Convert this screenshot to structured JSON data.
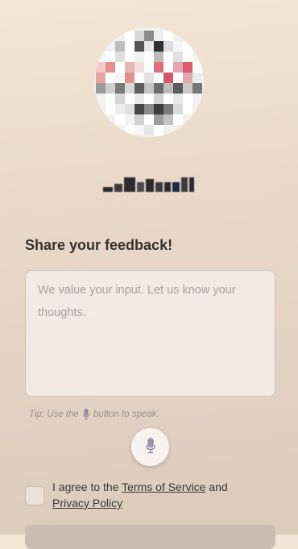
{
  "logo": {
    "name": "pixelated-logo",
    "rows": [
      [
        "",
        "",
        "",
        "#ffffff",
        "#d8d8d8",
        "#8a8a8a",
        "#f0f0f0",
        "#ffffff",
        "",
        "",
        ""
      ],
      [
        "",
        "#f2f2f2",
        "#bdbdbd",
        "#ffffff",
        "#555555",
        "#e8e8e8",
        "#2f2f2f",
        "#dcdcdc",
        "#f5f5f5",
        "#ffffff",
        ""
      ],
      [
        "#f4f4f4",
        "#ffffff",
        "#dedede",
        "#ffffff",
        "#f0f0f0",
        "#ffffff",
        "#bbbbbb",
        "#ffffff",
        "#e0e0e0",
        "#ffffff",
        "#f2f2f2"
      ],
      [
        "#f3c9c9",
        "#e88d8d",
        "#ffffff",
        "#e4b6b6",
        "#f6dede",
        "#ffffff",
        "#e06d7a",
        "#ffffff",
        "#e6a5b0",
        "#d8606e",
        "#ffffff"
      ],
      [
        "#e7a3a3",
        "#ffffff",
        "#f6f6f6",
        "#e08f8f",
        "#ffffff",
        "#e2e2e2",
        "#ffffff",
        "#d85565",
        "#ffffff",
        "#e3a7ae",
        "#ececec"
      ],
      [
        "#9b9b9b",
        "#cfcfcf",
        "#7a7a7a",
        "#d8d8d8",
        "#5e5e5e",
        "#c4c4c4",
        "#6c6c6c",
        "#bebebe",
        "#5c5c5c",
        "#c9c9c9",
        "#777777"
      ],
      [
        "#f3f3f3",
        "#ffffff",
        "#d6d6d6",
        "#ffffff",
        "#eaeaea",
        "#ffffff",
        "#d2d2d2",
        "#ffffff",
        "#e8e8e8",
        "#ffffff",
        "#f1f1f1"
      ],
      [
        "",
        "#ffffff",
        "#ededed",
        "#e0e0e0",
        "#474747",
        "#8b8b8b",
        "#3e3e3e",
        "#7a7a7a",
        "#dcdcdc",
        "#ffffff",
        ""
      ],
      [
        "",
        "",
        "#ffffff",
        "#f3f3f3",
        "#d0d0d0",
        "#ffffff",
        "#9d9d9d",
        "#c2c2c2",
        "#ffffff",
        "",
        ""
      ],
      [
        "",
        "",
        "",
        "#ffffff",
        "#f5f5f5",
        "#e6e6e6",
        "#ffffff",
        "",
        "",
        "",
        ""
      ]
    ]
  },
  "brand": {
    "name": "pixelated-brand-name",
    "blocks": [
      {
        "w": 12,
        "h": 6,
        "color": "#2b2b2f"
      },
      {
        "w": 10,
        "h": 10,
        "color": "#3a3a3f"
      },
      {
        "w": 14,
        "h": 18,
        "color": "#2b2b2f"
      },
      {
        "w": 9,
        "h": 12,
        "color": "#4a4a50"
      },
      {
        "w": 10,
        "h": 16,
        "color": "#2b2b2f"
      },
      {
        "w": 9,
        "h": 12,
        "color": "#3a3a3f"
      },
      {
        "w": 8,
        "h": 12,
        "color": "#2b2b2f"
      },
      {
        "w": 9,
        "h": 12,
        "color": "#1c2b4a"
      },
      {
        "w": 8,
        "h": 18,
        "color": "#3a3a3f"
      },
      {
        "w": 6,
        "h": 18,
        "color": "#2b2b2f"
      }
    ]
  },
  "form": {
    "heading": "Share your feedback!",
    "placeholder": "We value your input. Let us know your thoughts.",
    "value": "",
    "tip_before": "Tip: Use the",
    "tip_after": "button to speak.",
    "mic_icon": "microphone-icon"
  },
  "agreement": {
    "prefix": "I agree to the ",
    "terms_link": "Terms of Service",
    "middle": " and ",
    "privacy_link": "Privacy Policy",
    "checked": false
  },
  "colors": {
    "background_top": "#f4e6d6",
    "background_bottom": "#dccbbb",
    "submit": "#cbbcb1",
    "mic_accent": "#8a6f9e"
  }
}
